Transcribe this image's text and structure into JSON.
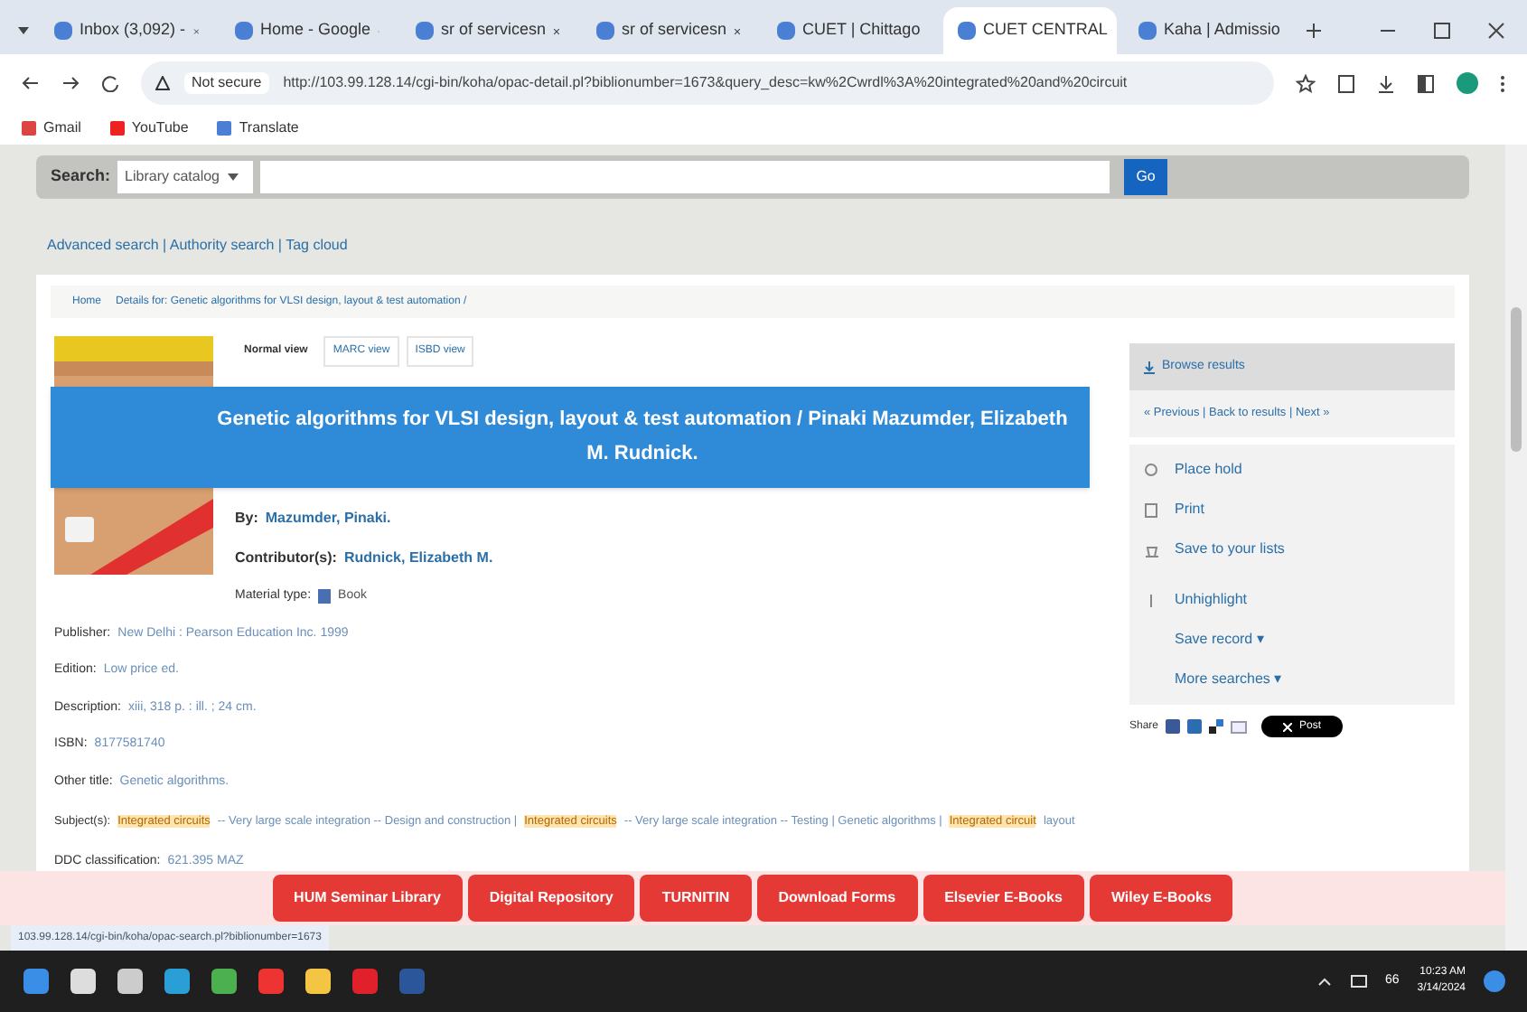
{
  "browser": {
    "tabs": [
      {
        "label": "Inbox (3,092) -",
        "selected": false
      },
      {
        "label": "Home - Google",
        "selected": false
      },
      {
        "label": "sr of servicesn",
        "selected": false
      },
      {
        "label": "sr of servicesn",
        "selected": false
      },
      {
        "label": "CUET | Chittago",
        "selected": false
      },
      {
        "label": "CUET CENTRAL",
        "selected": true
      },
      {
        "label": "Kaha | Admissio",
        "selected": false
      }
    ],
    "security": "Not secure",
    "url": "http://103.99.128.14/cgi-bin/koha/opac-detail.pl?biblionumber=1673&query_desc=kw%2Cwrdl%3A%20integrated%20and%20circuit",
    "bookmarks": [
      "Gmail",
      "YouTube",
      "Translate"
    ]
  },
  "search": {
    "label": "Search:",
    "scope": "Library catalog",
    "button": "Go"
  },
  "search_links": "Advanced search | Authority search | Tag cloud",
  "breadcrumb": [
    "Home",
    "Details for: Genetic algorithms for VLSI design, layout & test automation /"
  ],
  "views": [
    {
      "label": "Normal view",
      "selected": true
    },
    {
      "label": "MARC view",
      "selected": false
    },
    {
      "label": "ISBD view",
      "selected": false
    }
  ],
  "title": "Genetic algorithms for VLSI design, layout & test automation / Pinaki Mazumder, Elizabeth M. Rudnick.",
  "fields": [
    {
      "label": "By:",
      "value": "Mazumder, Pinaki.",
      "kind": "author"
    },
    {
      "label": "Contributor(s):",
      "value": "Rudnick, Elizabeth M.",
      "kind": "author"
    },
    {
      "label": "Material type:",
      "value": "Book",
      "kind": "type"
    },
    {
      "label": "Publisher:",
      "value": "New Delhi : Pearson Education Inc. 1999",
      "kind": "plain"
    },
    {
      "label": "Edition:",
      "value": "Low price ed.",
      "kind": "plain"
    },
    {
      "label": "Description:",
      "value": "xiii, 318 p. : ill. ; 24 cm.",
      "kind": "plain"
    },
    {
      "label": "ISBN:",
      "value": "8177581740",
      "kind": "plain"
    },
    {
      "label": "Other title:",
      "value": "Genetic algorithms.",
      "kind": "plain"
    }
  ],
  "subjects_label": "Subject(s):",
  "subjects": [
    {
      "text": "Integrated circuits",
      "highlighted": true
    },
    {
      "text": "-- Very large scale integration -- Design and construction |",
      "highlighted": false
    },
    {
      "text": "Integrated circuits",
      "highlighted": true
    },
    {
      "text": "-- Very large scale integration -- Testing | Genetic algorithms |",
      "highlighted": false
    },
    {
      "text": "Integrated circuit",
      "highlighted": true
    },
    {
      "text": "layout",
      "highlighted": false
    }
  ],
  "ddc": {
    "label": "DDC classification:",
    "value": "621.395 MAZ"
  },
  "sidebar": {
    "header": "Browse results",
    "pager": "« Previous | Back to results | Next »",
    "actions": [
      {
        "label": "Place hold",
        "kind": "hold"
      },
      {
        "label": "Print",
        "kind": "print"
      },
      {
        "label": "Save to your lists",
        "kind": "list"
      },
      {
        "label": "Unhighlight",
        "kind": "highlight"
      },
      {
        "label": "Save record ▾",
        "kind": "menu"
      },
      {
        "label": "More searches ▾",
        "kind": "menu"
      }
    ],
    "share_label": "Share",
    "post": "Post"
  },
  "footer_buttons": [
    "HUM Seminar Library",
    "Digital Repository",
    "TURNITIN",
    "Download Forms",
    "Elsevier E-Books",
    "Wiley E-Books"
  ],
  "status_url": "103.99.128.14/cgi-bin/koha/opac-search.pl?biblionumber=1673",
  "taskbar": {
    "time": "10:23 AM",
    "date": "3/14/2024",
    "temp": "66"
  }
}
